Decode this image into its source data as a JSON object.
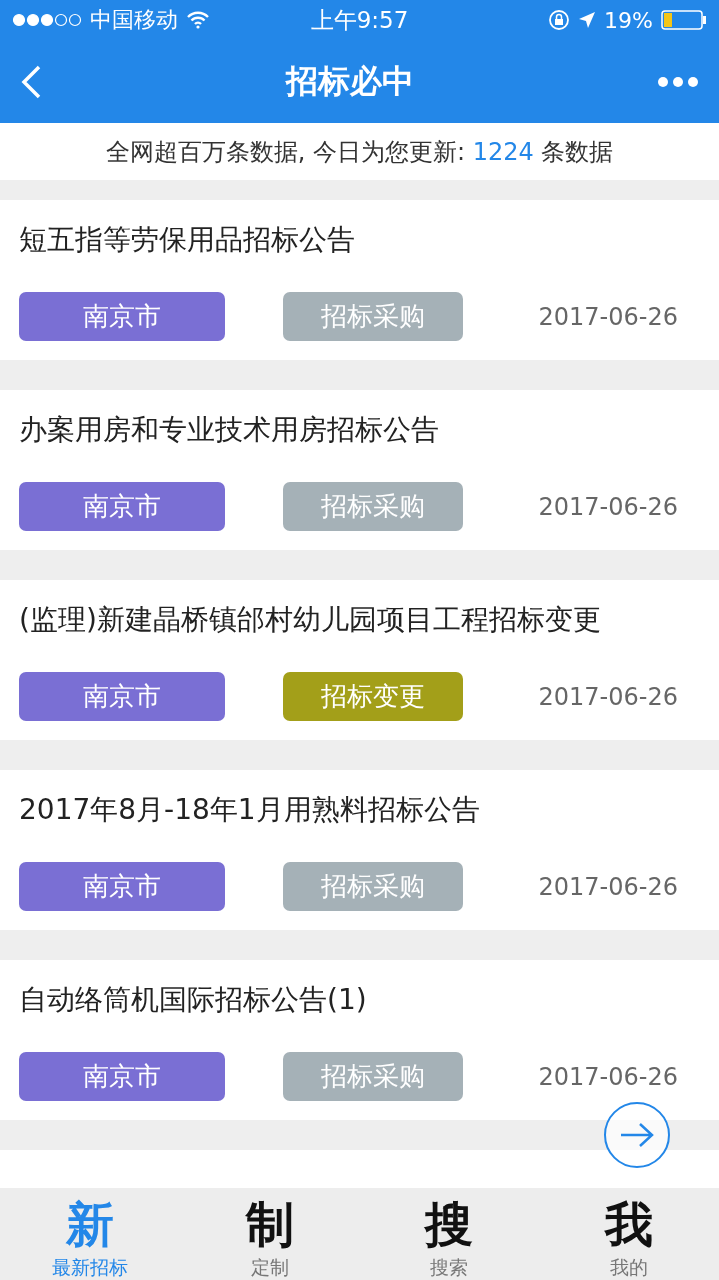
{
  "status_bar": {
    "carrier": "中国移动",
    "time": "上午9:57",
    "battery": "19%"
  },
  "nav": {
    "title": "招标必中"
  },
  "banner": {
    "text": "全网超百万条数据, 今日为您更新: ",
    "count": "1224",
    "suffix": " 条数据"
  },
  "items": [
    {
      "title": "短五指等劳保用品招标公告",
      "region": {
        "label": "南京市",
        "color": "#7a6fd4"
      },
      "type": {
        "label": "招标采购",
        "color": "#a5b1b7"
      },
      "date": "2017-06-26"
    },
    {
      "title": "办案用房和专业技术用房招标公告",
      "region": {
        "label": "南京市",
        "color": "#7a6fd4"
      },
      "type": {
        "label": "招标采购",
        "color": "#a5b1b7"
      },
      "date": "2017-06-26"
    },
    {
      "title": "(监理)新建晶桥镇邰村幼儿园项目工程招标变更",
      "region": {
        "label": "南京市",
        "color": "#7a6fd4"
      },
      "type": {
        "label": "招标变更",
        "color": "#a39f19"
      },
      "date": "2017-06-26"
    },
    {
      "title": "2017年8月-18年1月用熟料招标公告",
      "region": {
        "label": "南京市",
        "color": "#7a6fd4"
      },
      "type": {
        "label": "招标采购",
        "color": "#a5b1b7"
      },
      "date": "2017-06-26"
    },
    {
      "title": "自动络筒机国际招标公告(1)",
      "region": {
        "label": "南京市",
        "color": "#7a6fd4"
      },
      "type": {
        "label": "招标采购",
        "color": "#a5b1b7"
      },
      "date": "2017-06-26"
    }
  ],
  "tabs": [
    {
      "glyph": "新",
      "label": "最新招标",
      "selected": true
    },
    {
      "glyph": "制",
      "label": "定制",
      "selected": false
    },
    {
      "glyph": "搜",
      "label": "搜索",
      "selected": false
    },
    {
      "glyph": "我",
      "label": "我的",
      "selected": false
    }
  ]
}
